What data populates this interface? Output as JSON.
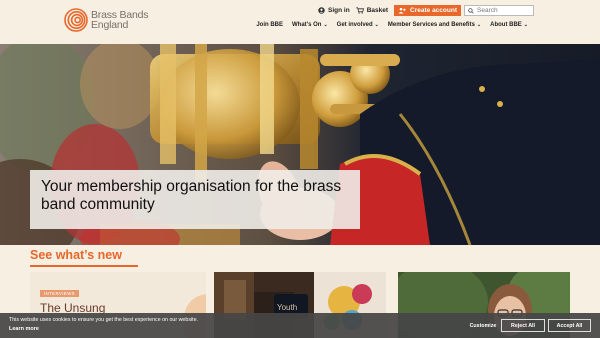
{
  "brand": {
    "line1": "Brass Bands",
    "line2": "England",
    "accent": "#e8672a"
  },
  "topbar": {
    "signin_label": "Sign in",
    "basket_label": "Basket",
    "create_label": "Create account",
    "search_placeholder": "Search"
  },
  "nav": {
    "items": [
      {
        "label": "Join BBE",
        "dropdown": false
      },
      {
        "label": "What's On",
        "dropdown": true
      },
      {
        "label": "Get involved",
        "dropdown": true
      },
      {
        "label": "Member Services and Benefits",
        "dropdown": true
      },
      {
        "label": "About BBE",
        "dropdown": true
      }
    ],
    "chevron": "⌄"
  },
  "hero": {
    "heading": "Your membership organisation for the brass band community"
  },
  "section": {
    "title": "See what’s new"
  },
  "cards": [
    {
      "tag": "INTERVIEWS",
      "title": "The Unsung"
    },
    {
      "tag": "",
      "title": ""
    },
    {
      "tag": "",
      "title": ""
    }
  ],
  "cookie": {
    "message": "This website uses cookies to ensure you get the best experience on our website.",
    "learn_more": "Learn more",
    "customize_label": "Customize",
    "reject_label": "Reject All",
    "accept_label": "Accept All"
  },
  "icons": [
    "logo-rings-icon",
    "user-icon",
    "basket-icon",
    "create-account-icon",
    "search-icon"
  ]
}
